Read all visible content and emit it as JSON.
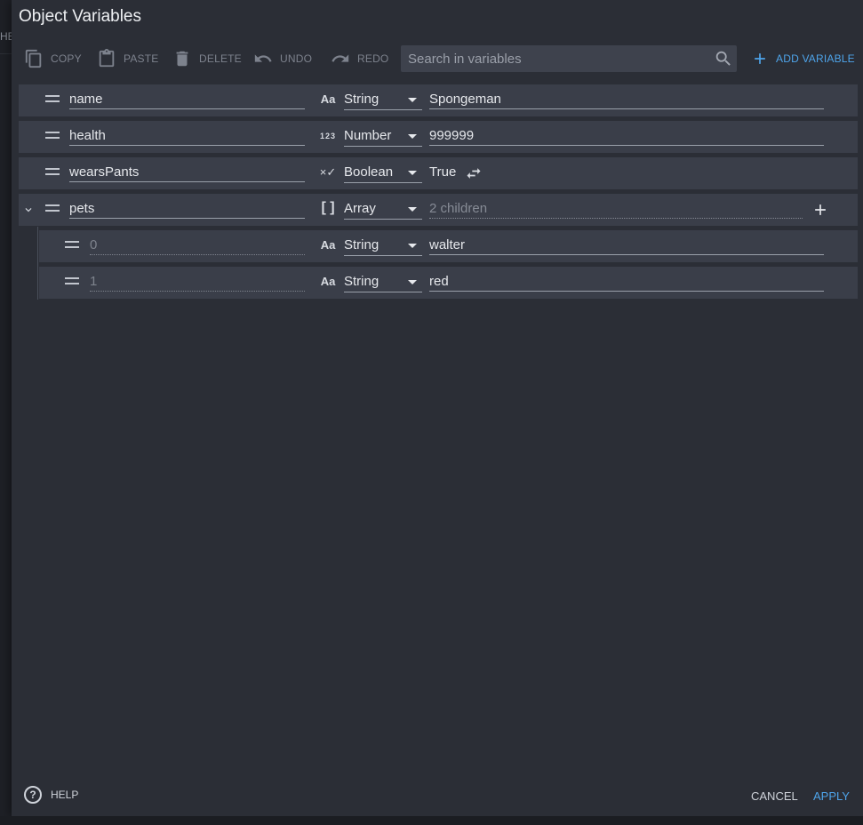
{
  "backdrop": {
    "peek_text": "HE"
  },
  "dialog": {
    "title": "Object Variables"
  },
  "toolbar": {
    "copy_label": "COPY",
    "paste_label": "PASTE",
    "delete_label": "DELETE",
    "undo_label": "UNDO",
    "redo_label": "REDO",
    "search_placeholder": "Search in variables",
    "search_value": "",
    "add_variable_label": "ADD VARIABLE"
  },
  "variables": [
    {
      "name": "name",
      "type_icon": "Aa",
      "type": "String",
      "value": "Spongeman"
    },
    {
      "name": "health",
      "type_icon": "123",
      "type": "Number",
      "value": "999999"
    },
    {
      "name": "wearsPants",
      "type_icon": "×✓",
      "type": "Boolean",
      "value": "True"
    },
    {
      "name": "pets",
      "type_icon": "[ ]",
      "type": "Array",
      "value": "2 children"
    }
  ],
  "children": [
    {
      "name": "0",
      "type_icon": "Aa",
      "type": "String",
      "value": "walter"
    },
    {
      "name": "1",
      "type_icon": "Aa",
      "type": "String",
      "value": "red"
    }
  ],
  "footer": {
    "help_label": "HELP",
    "cancel_label": "CANCEL",
    "apply_label": "APPLY"
  },
  "colors": {
    "dialog_bg": "#2b2e36",
    "row_bg": "#3a3e49",
    "accent": "#4ea4ea",
    "disabled_text": "#7d828d"
  },
  "icons": {
    "copy": "copy-icon",
    "paste": "clipboard-icon",
    "delete": "trash-icon",
    "undo": "undo-icon",
    "redo": "redo-icon",
    "search": "search-icon",
    "add": "plus-icon",
    "drag": "drag-handle-icon",
    "expand": "chevron-down-icon",
    "toggle": "swap-icon",
    "help": "help-circle-icon"
  }
}
